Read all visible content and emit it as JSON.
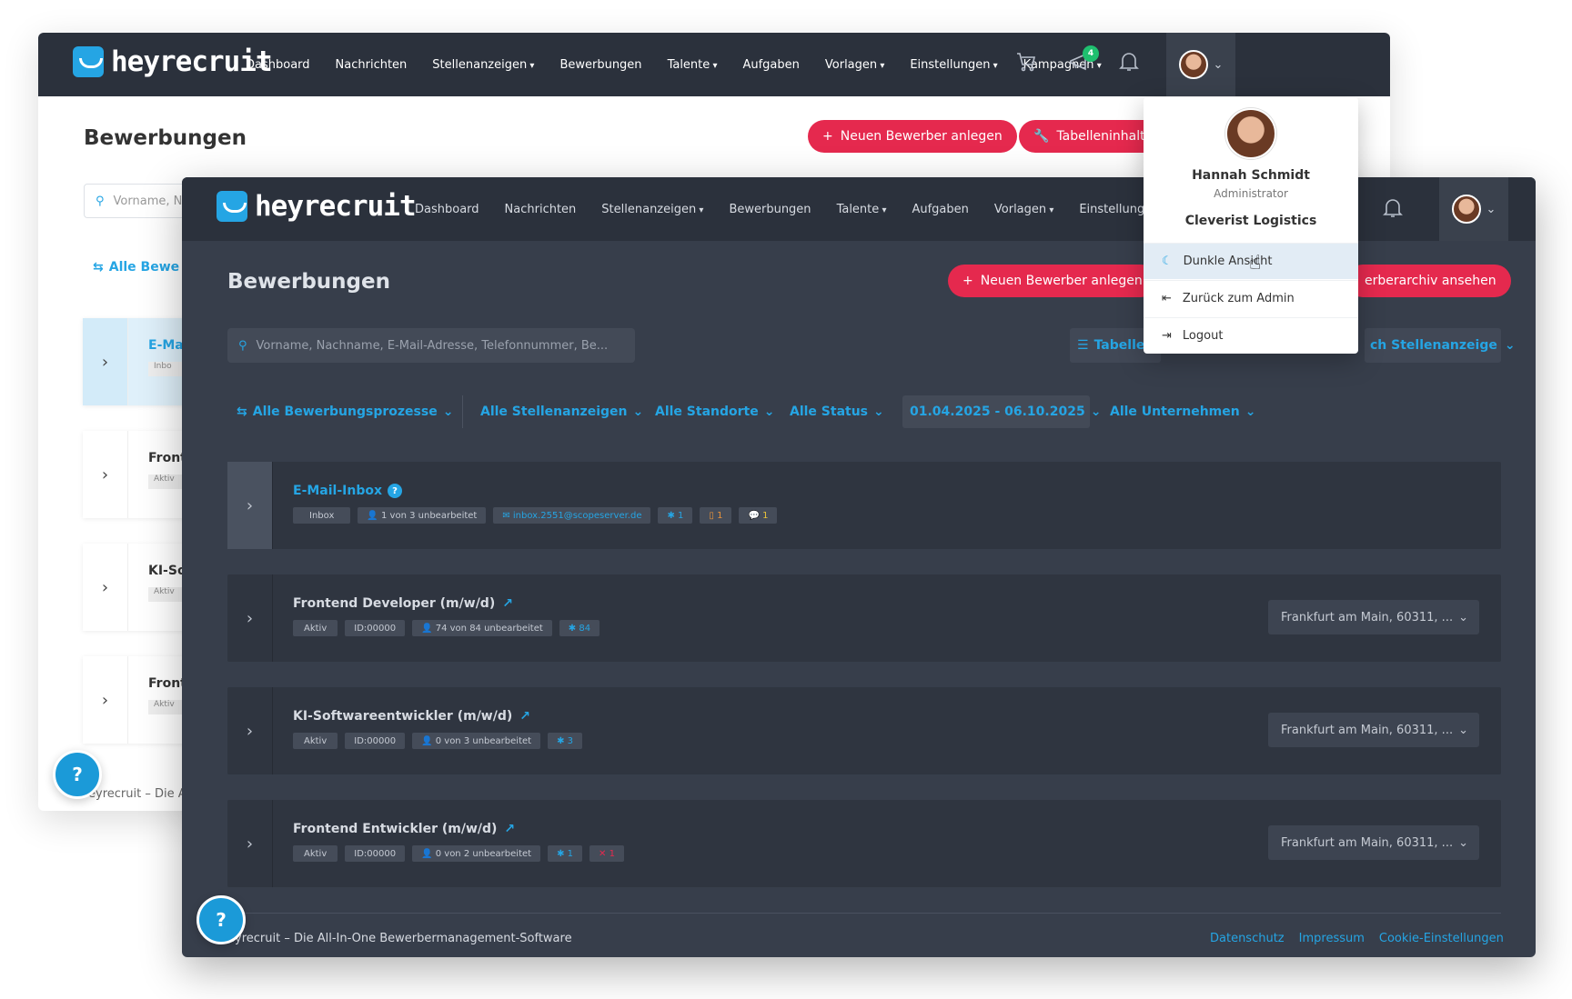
{
  "app": {
    "logo_text": "heyrecruit"
  },
  "nav": {
    "items": [
      {
        "label": "Dashboard",
        "dropdown": false
      },
      {
        "label": "Nachrichten",
        "dropdown": false
      },
      {
        "label": "Stellenanzeigen",
        "dropdown": true
      },
      {
        "label": "Bewerbungen",
        "dropdown": false
      },
      {
        "label": "Talente",
        "dropdown": true
      },
      {
        "label": "Aufgaben",
        "dropdown": false
      },
      {
        "label": "Vorlagen",
        "dropdown": true
      },
      {
        "label": "Einstellungen",
        "dropdown": true
      },
      {
        "label": "Kampagnen",
        "dropdown": true
      }
    ],
    "notification_badge": "4"
  },
  "light": {
    "page_title": "Bewerbungen",
    "btn_new": "Neuen Bewerber anlegen",
    "btn_table": "Tabelleninhalt",
    "search_placeholder": "Vorname, N",
    "filter_processes": "Alle Bewe",
    "cards": [
      {
        "title": "E-Ma",
        "tag": "Inbo"
      },
      {
        "title": "Front",
        "tag": "Aktiv"
      },
      {
        "title": "KI-So",
        "tag": "Aktiv"
      },
      {
        "title": "Front",
        "tag": "Aktiv"
      }
    ],
    "footer": "eyrecruit – Die A"
  },
  "dark": {
    "page_title": "Bewerbungen",
    "btn_new": "Neuen Bewerber anlegen",
    "btn_archive": "erberarchiv ansehen",
    "search_placeholder": "Vorname, Nachname, E-Mail-Adresse, Telefonnummer, Be...",
    "view_toggle": "Tabelle",
    "sort_dropdown": "ch Stellenanzeige",
    "filters": {
      "processes": "Alle Bewerbungsprozesse",
      "jobs": "Alle Stellenanzeigen",
      "locations": "Alle Standorte",
      "status": "Alle Status",
      "date_range": "01.04.2025 - 06.10.2025",
      "companies": "Alle Unternehmen"
    },
    "inbox": {
      "title": "E-Mail-Inbox",
      "tag_inbox": "Inbox",
      "unprocessed": "1 von 3 unbearbeitet",
      "email": "inbox.2551@scopeserver.de",
      "new_count": "1",
      "doc_count": "1",
      "msg_count": "1"
    },
    "jobs": [
      {
        "title": "Frontend Developer (m/w/d)",
        "status": "Aktiv",
        "id": "ID:00000",
        "unprocessed": "74 von 84 unbearbeitet",
        "new_count": "84",
        "rejected": "",
        "location": "Frankfurt am Main, 60311, ..."
      },
      {
        "title": "KI-Softwareentwickler (m/w/d)",
        "status": "Aktiv",
        "id": "ID:00000",
        "unprocessed": "0 von 3 unbearbeitet",
        "new_count": "3",
        "rejected": "",
        "location": "Frankfurt am Main, 60311, ..."
      },
      {
        "title": "Frontend Entwickler (m/w/d)",
        "status": "Aktiv",
        "id": "ID:00000",
        "unprocessed": "0 von 2 unbearbeitet",
        "new_count": "1",
        "rejected": "1",
        "location": "Frankfurt am Main, 60311, ..."
      }
    ],
    "footer_text": "eyrecruit – Die All-In-One Bewerbermanagement-Software",
    "footer_links": [
      "Datenschutz",
      "Impressum",
      "Cookie-Einstellungen"
    ]
  },
  "user_menu": {
    "name": "Hannah Schmidt",
    "role": "Administrator",
    "company": "Cleverist Logistics",
    "items": [
      "Dunkle Ansicht",
      "Zurück zum Admin",
      "Logout"
    ]
  },
  "help_label": "?",
  "colors": {
    "accent": "#25a5e4",
    "brand_red": "#e5294e",
    "dark_bg": "#373e4b",
    "nav_bg": "#2b313c"
  }
}
